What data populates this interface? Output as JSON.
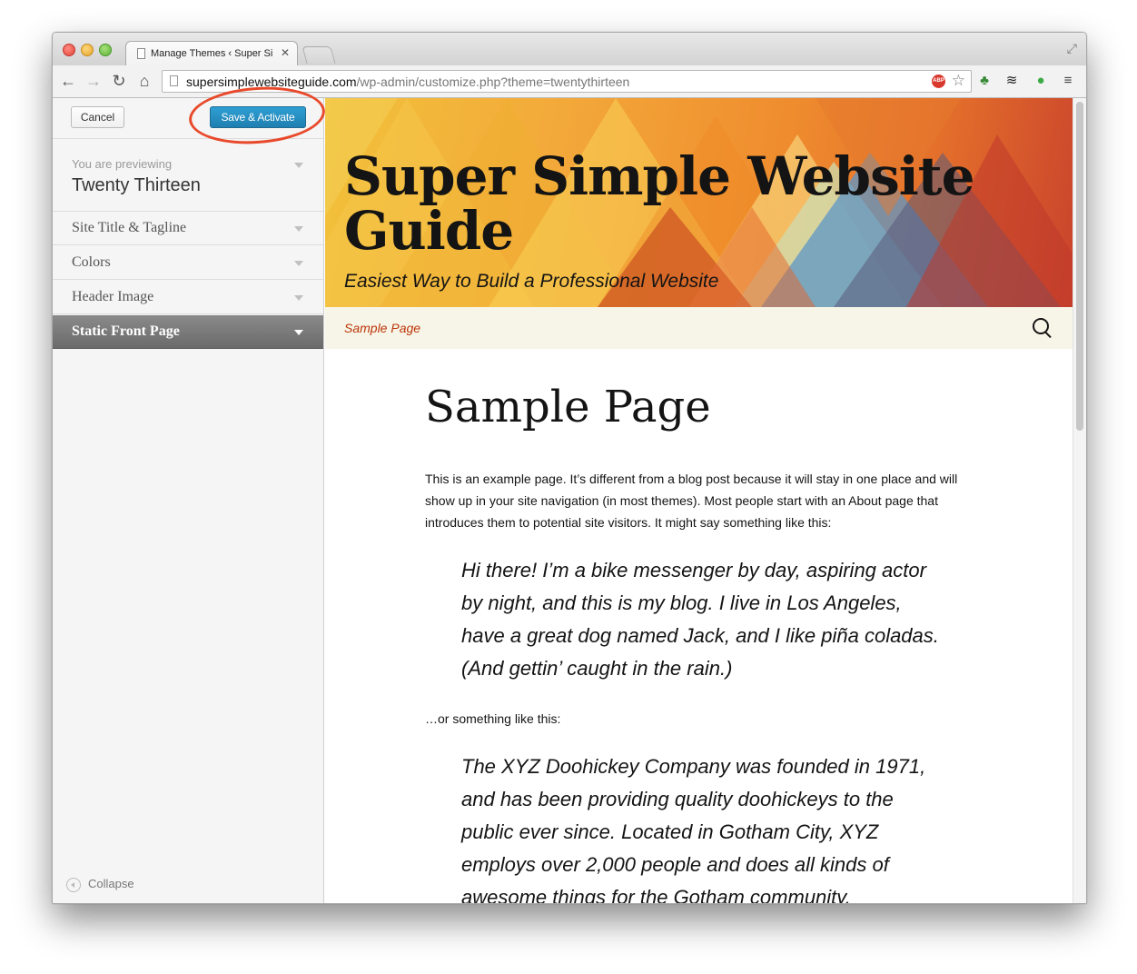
{
  "browser": {
    "tab_title": "Manage Themes ‹ Super Si",
    "url_host": "supersimplewebsiteguide.com",
    "url_path": "/wp-admin/customize.php?theme=twentythirteen",
    "abp_label": "ABP"
  },
  "customizer": {
    "cancel_label": "Cancel",
    "save_label": "Save & Activate",
    "preview_label": "You are previewing",
    "theme_name": "Twenty Thirteen",
    "sections": [
      {
        "label": "Site Title & Tagline",
        "active": false
      },
      {
        "label": "Colors",
        "active": false
      },
      {
        "label": "Header Image",
        "active": false
      },
      {
        "label": "Static Front Page",
        "active": true
      }
    ],
    "collapse_label": "Collapse"
  },
  "site": {
    "title": "Super Simple Website Guide",
    "tagline": "Easiest Way to Build a Professional Website",
    "nav_link": "Sample Page",
    "page_title": "Sample Page",
    "paragraph1": "This is an example page. It’s different from a blog post because it will stay in one place and will show up in your site navigation (in most themes). Most people start with an About page that introduces them to potential site visitors. It might say something like this:",
    "quote1": "Hi there! I’m a bike messenger by day, aspiring actor by night, and this is my blog. I live in Los Angeles, have a great dog named Jack, and I like piña coladas. (And gettin’ caught in the rain.)",
    "paragraph2": "…or something like this:",
    "quote2": "The XYZ Doohickey Company was founded in 1971, and has been providing quality doohickeys to the public ever since. Located in Gotham City, XYZ employs over 2,000 people and does all kinds of awesome things for the Gotham community."
  },
  "colors": {
    "accent_button": "#2185ba",
    "highlight_ring": "#e8492a",
    "nav_link": "#bc360a"
  }
}
